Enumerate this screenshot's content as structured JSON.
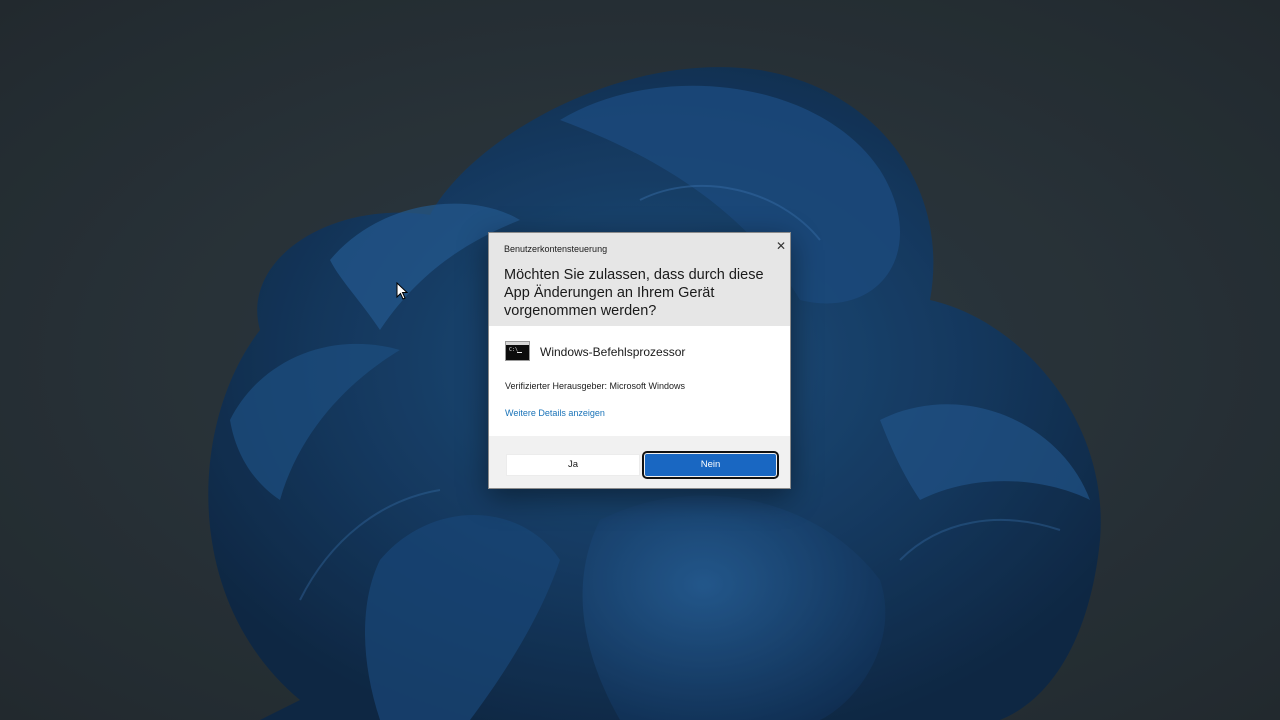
{
  "dialog": {
    "caption": "Benutzerkontensteuerung",
    "close_glyph": "✕",
    "question": "Möchten Sie zulassen, dass durch diese App Änderungen an Ihrem Gerät vorgenommen werden?",
    "app_name": "Windows-Befehlsprozessor",
    "publisher": "Verifizierter Herausgeber: Microsoft Windows",
    "details_link": "Weitere Details anzeigen",
    "yes_label": "Ja",
    "no_label": "Nein"
  },
  "icons": {
    "app": "command-prompt-icon",
    "close": "close-icon",
    "cursor": "mouse-pointer-icon"
  },
  "colors": {
    "accent": "#1967c2",
    "link": "#1a73b8",
    "header_bg": "#e6e6e6",
    "footer_bg": "#f1f1f1",
    "desktop_bg": "#2a3339"
  }
}
